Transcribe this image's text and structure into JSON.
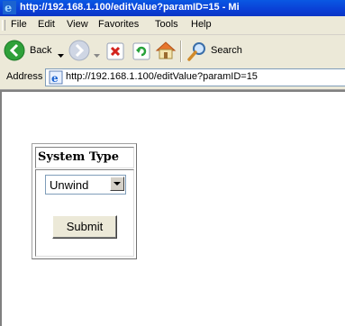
{
  "window": {
    "title": "http://192.168.1.100/editValue?paramID=15 - Mi"
  },
  "menu": {
    "items": [
      "File",
      "Edit",
      "View",
      "Favorites",
      "Tools",
      "Help"
    ]
  },
  "toolbar": {
    "back_label": "Back",
    "search_label": "Search"
  },
  "address": {
    "label": "Address",
    "url": "http://192.168.1.100/editValue?paramID=15"
  },
  "form": {
    "field_label": "System Type",
    "select_value": "Unwind",
    "submit_label": "Submit"
  },
  "icons": [
    "ie-icon",
    "back-arrow-icon",
    "forward-arrow-icon",
    "stop-icon",
    "refresh-icon",
    "home-icon",
    "search-icon",
    "chevron-down-icon"
  ]
}
